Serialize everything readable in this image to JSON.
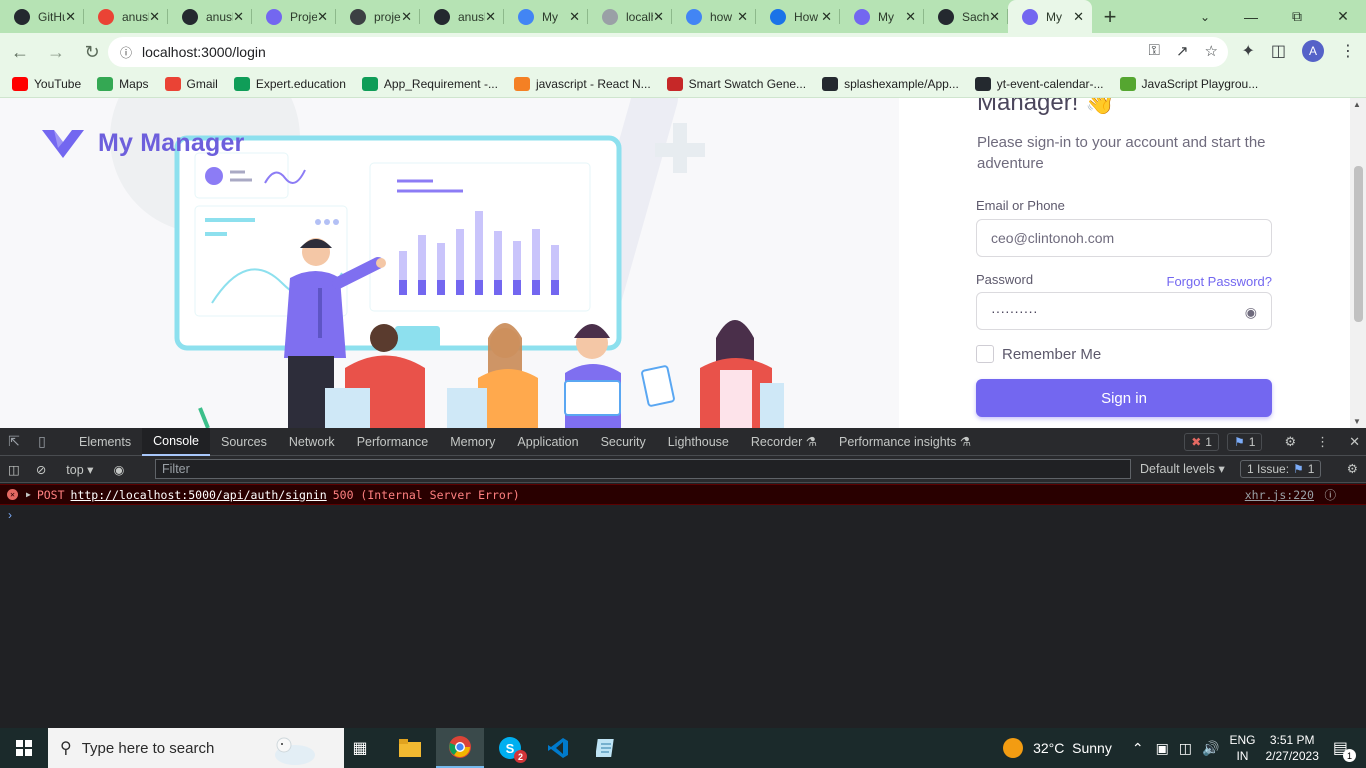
{
  "browser": {
    "tabs": [
      {
        "title": "GitHub",
        "favicon": "github-icon",
        "color": "#24292f"
      },
      {
        "title": "anusha",
        "favicon": "gmail-icon",
        "color": "#ea4335"
      },
      {
        "title": "anusha",
        "favicon": "github-icon",
        "color": "#24292f"
      },
      {
        "title": "Project",
        "favicon": "vuexy-icon",
        "color": "#7367f0"
      },
      {
        "title": "project",
        "favicon": "globe-icon",
        "color": "#3c4043"
      },
      {
        "title": "anusha",
        "favicon": "github-icon",
        "color": "#24292f"
      },
      {
        "title": "My",
        "favicon": "docs-icon",
        "color": "#4285f4"
      },
      {
        "title": "localhost",
        "favicon": "globe-icon",
        "color": "#9aa0a6"
      },
      {
        "title": "how",
        "favicon": "google-icon",
        "color": "#4285f4"
      },
      {
        "title": "How",
        "favicon": "refresh-icon",
        "color": "#1a73e8"
      },
      {
        "title": "My",
        "favicon": "vuexy-icon",
        "color": "#7367f0"
      },
      {
        "title": "Sachin",
        "favicon": "github-icon",
        "color": "#24292f"
      },
      {
        "title": "My",
        "favicon": "vuexy-icon",
        "color": "#7367f0",
        "active": true
      }
    ],
    "url": "localhost:3000/login",
    "bookmarks": [
      {
        "label": "YouTube",
        "icon": "youtube-icon",
        "color": "#ff0000"
      },
      {
        "label": "Maps",
        "icon": "maps-icon",
        "color": "#34a853"
      },
      {
        "label": "Gmail",
        "icon": "gmail-icon",
        "color": "#ea4335"
      },
      {
        "label": "Expert.education",
        "icon": "plus-box-icon",
        "color": "#0f9d58"
      },
      {
        "label": "App_Requirement -...",
        "icon": "plus-box-icon",
        "color": "#0f9d58"
      },
      {
        "label": "javascript - React N...",
        "icon": "stackoverflow-icon",
        "color": "#f48024"
      },
      {
        "label": "Smart Swatch Gene...",
        "icon": "flag-icon",
        "color": "#c62828"
      },
      {
        "label": "splashexample/App...",
        "icon": "github-icon",
        "color": "#24292f"
      },
      {
        "label": "yt-event-calendar-...",
        "icon": "github-icon",
        "color": "#24292f"
      },
      {
        "label": "JavaScript Playgrou...",
        "icon": "js-diamond-icon",
        "color": "#55a630"
      }
    ],
    "avatar_letter": "A"
  },
  "page": {
    "brand": "My Manager",
    "welcome": "Manager! 👋",
    "subtitle": "Please sign-in to your account and start the adventure",
    "email_label": "Email or Phone",
    "email_value": "ceo@clintonoh.com",
    "password_label": "Password",
    "forgot_label": "Forgot Password?",
    "password_value": "··········",
    "remember_label": "Remember Me",
    "signin_label": "Sign in",
    "accent": "#7367f0"
  },
  "devtools": {
    "tabs": [
      "Elements",
      "Console",
      "Sources",
      "Network",
      "Performance",
      "Memory",
      "Application",
      "Security",
      "Lighthouse",
      "Recorder ⚗",
      "Performance insights ⚗"
    ],
    "active_tab": "Console",
    "error_count": "1",
    "message_count": "1",
    "context": "top",
    "filter_placeholder": "Filter",
    "levels": "Default levels",
    "issues_label": "1 Issue:",
    "issues_count": "1",
    "error": {
      "method": "POST",
      "url": "http://localhost:5000/api/auth/signin",
      "status": "500 (Internal Server Error)",
      "source": "xhr.js:220"
    }
  },
  "taskbar": {
    "search_placeholder": "Type here to search",
    "weather": "32°C  Sunny",
    "lang_top": "ENG",
    "lang_bottom": "IN",
    "time": "3:51 PM",
    "date": "2/27/2023",
    "skype_badge": "2",
    "notif_count": "1"
  }
}
